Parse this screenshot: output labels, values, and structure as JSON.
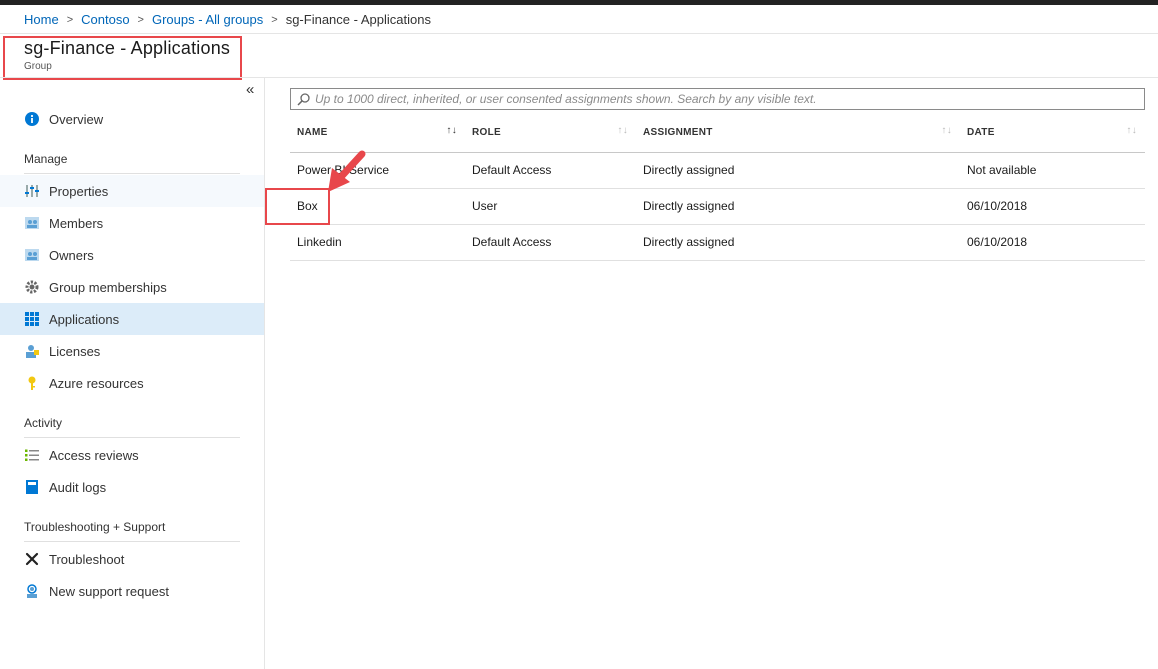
{
  "breadcrumb": {
    "items": [
      "Home",
      "Contoso",
      "Groups - All groups"
    ],
    "current": "sg-Finance - Applications"
  },
  "header": {
    "title": "sg-Finance - Applications",
    "subtitle": "Group"
  },
  "sidebar": {
    "collapse_glyph": "«",
    "overview": "Overview",
    "sections": [
      {
        "label": "Manage",
        "items": [
          "Properties",
          "Members",
          "Owners",
          "Group memberships",
          "Applications",
          "Licenses",
          "Azure resources"
        ]
      },
      {
        "label": "Activity",
        "items": [
          "Access reviews",
          "Audit logs"
        ]
      },
      {
        "label": "Troubleshooting + Support",
        "items": [
          "Troubleshoot",
          "New support request"
        ]
      }
    ],
    "selected": "Applications"
  },
  "search": {
    "placeholder": "Up to 1000 direct, inherited, or user consented assignments shown. Search by any visible text."
  },
  "table": {
    "columns": [
      "NAME",
      "ROLE",
      "ASSIGNMENT",
      "DATE"
    ],
    "rows": [
      [
        "Power BI Service",
        "Default Access",
        "Directly assigned",
        "Not available"
      ],
      [
        "Box",
        "User",
        "Directly assigned",
        "06/10/2018"
      ],
      [
        "Linkedin",
        "Default Access",
        "Directly assigned",
        "06/10/2018"
      ]
    ]
  },
  "colors": {
    "link": "#0066b8",
    "selected_bg": "#dcecf9",
    "highlight": "#e8474b",
    "icon_blue": "#0078d4"
  }
}
